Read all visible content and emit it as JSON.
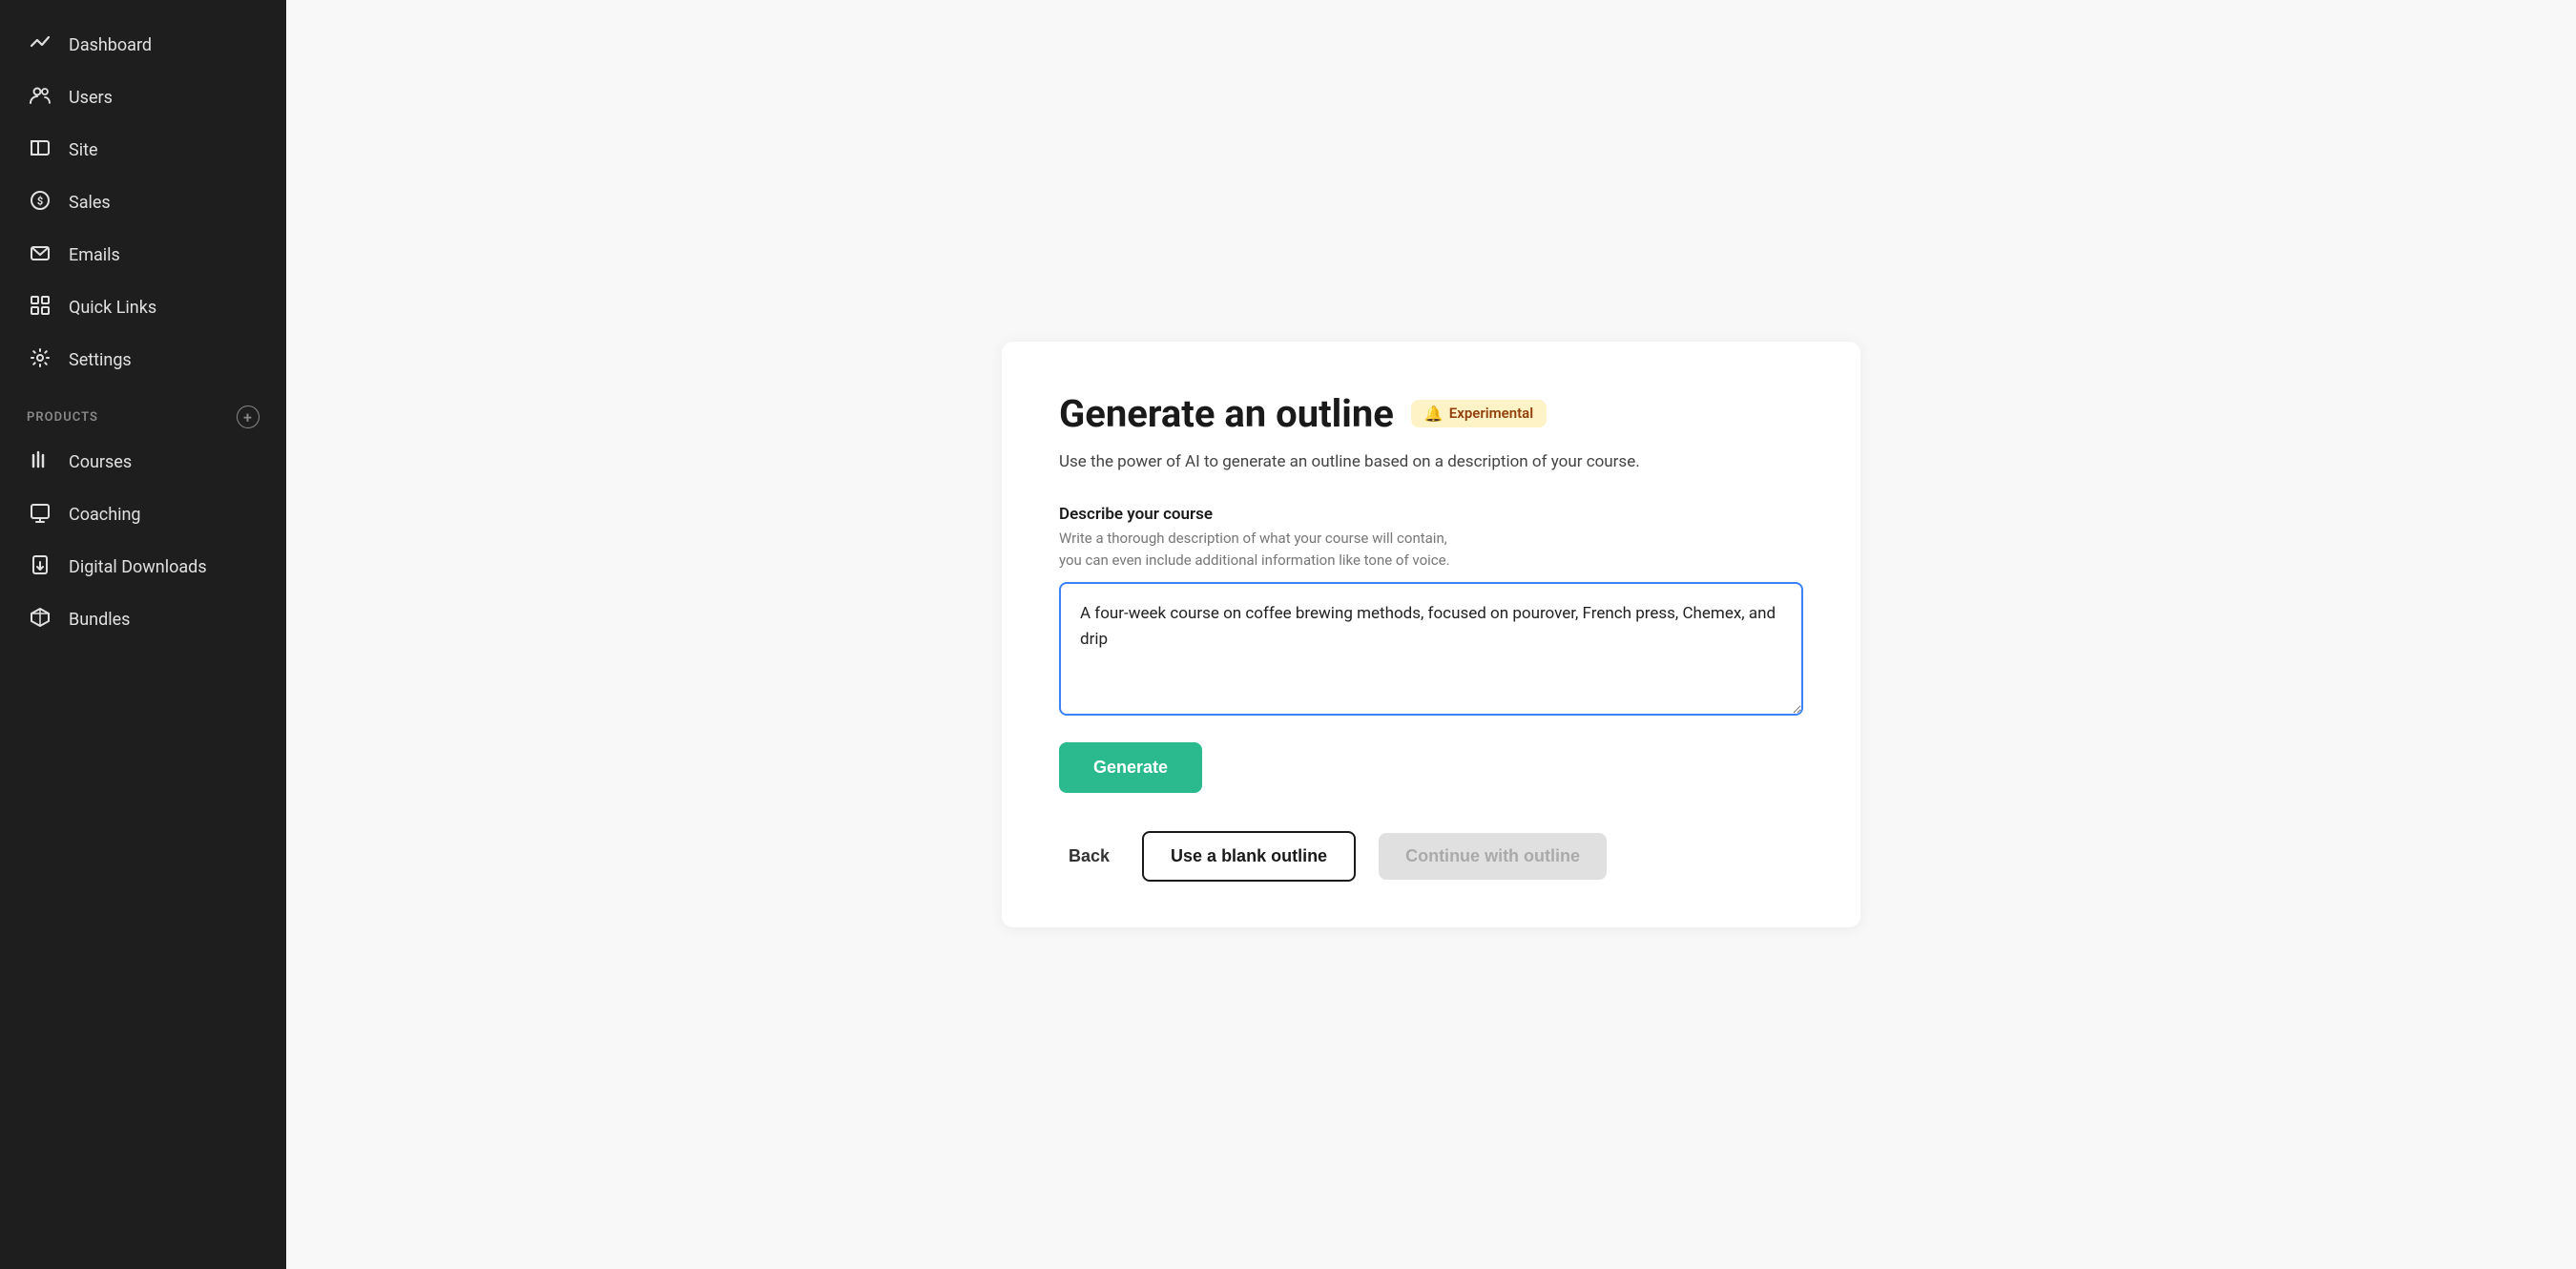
{
  "sidebar": {
    "items": [
      {
        "id": "dashboard",
        "label": "Dashboard",
        "icon": "dashboard-icon"
      },
      {
        "id": "users",
        "label": "Users",
        "icon": "users-icon"
      },
      {
        "id": "site",
        "label": "Site",
        "icon": "site-icon"
      },
      {
        "id": "sales",
        "label": "Sales",
        "icon": "sales-icon"
      },
      {
        "id": "emails",
        "label": "Emails",
        "icon": "emails-icon"
      },
      {
        "id": "quick-links",
        "label": "Quick Links",
        "icon": "quick-links-icon"
      },
      {
        "id": "settings",
        "label": "Settings",
        "icon": "settings-icon"
      }
    ],
    "section_label": "PRODUCTS",
    "add_button_title": "Add product",
    "product_items": [
      {
        "id": "courses",
        "label": "Courses",
        "icon": "courses-icon"
      },
      {
        "id": "coaching",
        "label": "Coaching",
        "icon": "coaching-icon"
      },
      {
        "id": "digital-downloads",
        "label": "Digital Downloads",
        "icon": "digital-downloads-icon"
      },
      {
        "id": "bundles",
        "label": "Bundles",
        "icon": "bundles-icon"
      }
    ]
  },
  "main": {
    "title": "Generate an outline",
    "badge_text": "Experimental",
    "badge_icon": "🔔",
    "subtitle": "Use the power of AI to generate an outline based on a description of your course.",
    "field_label": "Describe your course",
    "field_hint_line1": "Write a thorough description of what your course will contain,",
    "field_hint_line2": "you can even include additional information like tone of voice.",
    "textarea_value": "A four-week course on coffee brewing methods, focused on pourover, French press, Chemex, and drip",
    "generate_button": "Generate",
    "back_button": "Back",
    "blank_outline_button": "Use a blank outline",
    "continue_button": "Continue with outline"
  }
}
